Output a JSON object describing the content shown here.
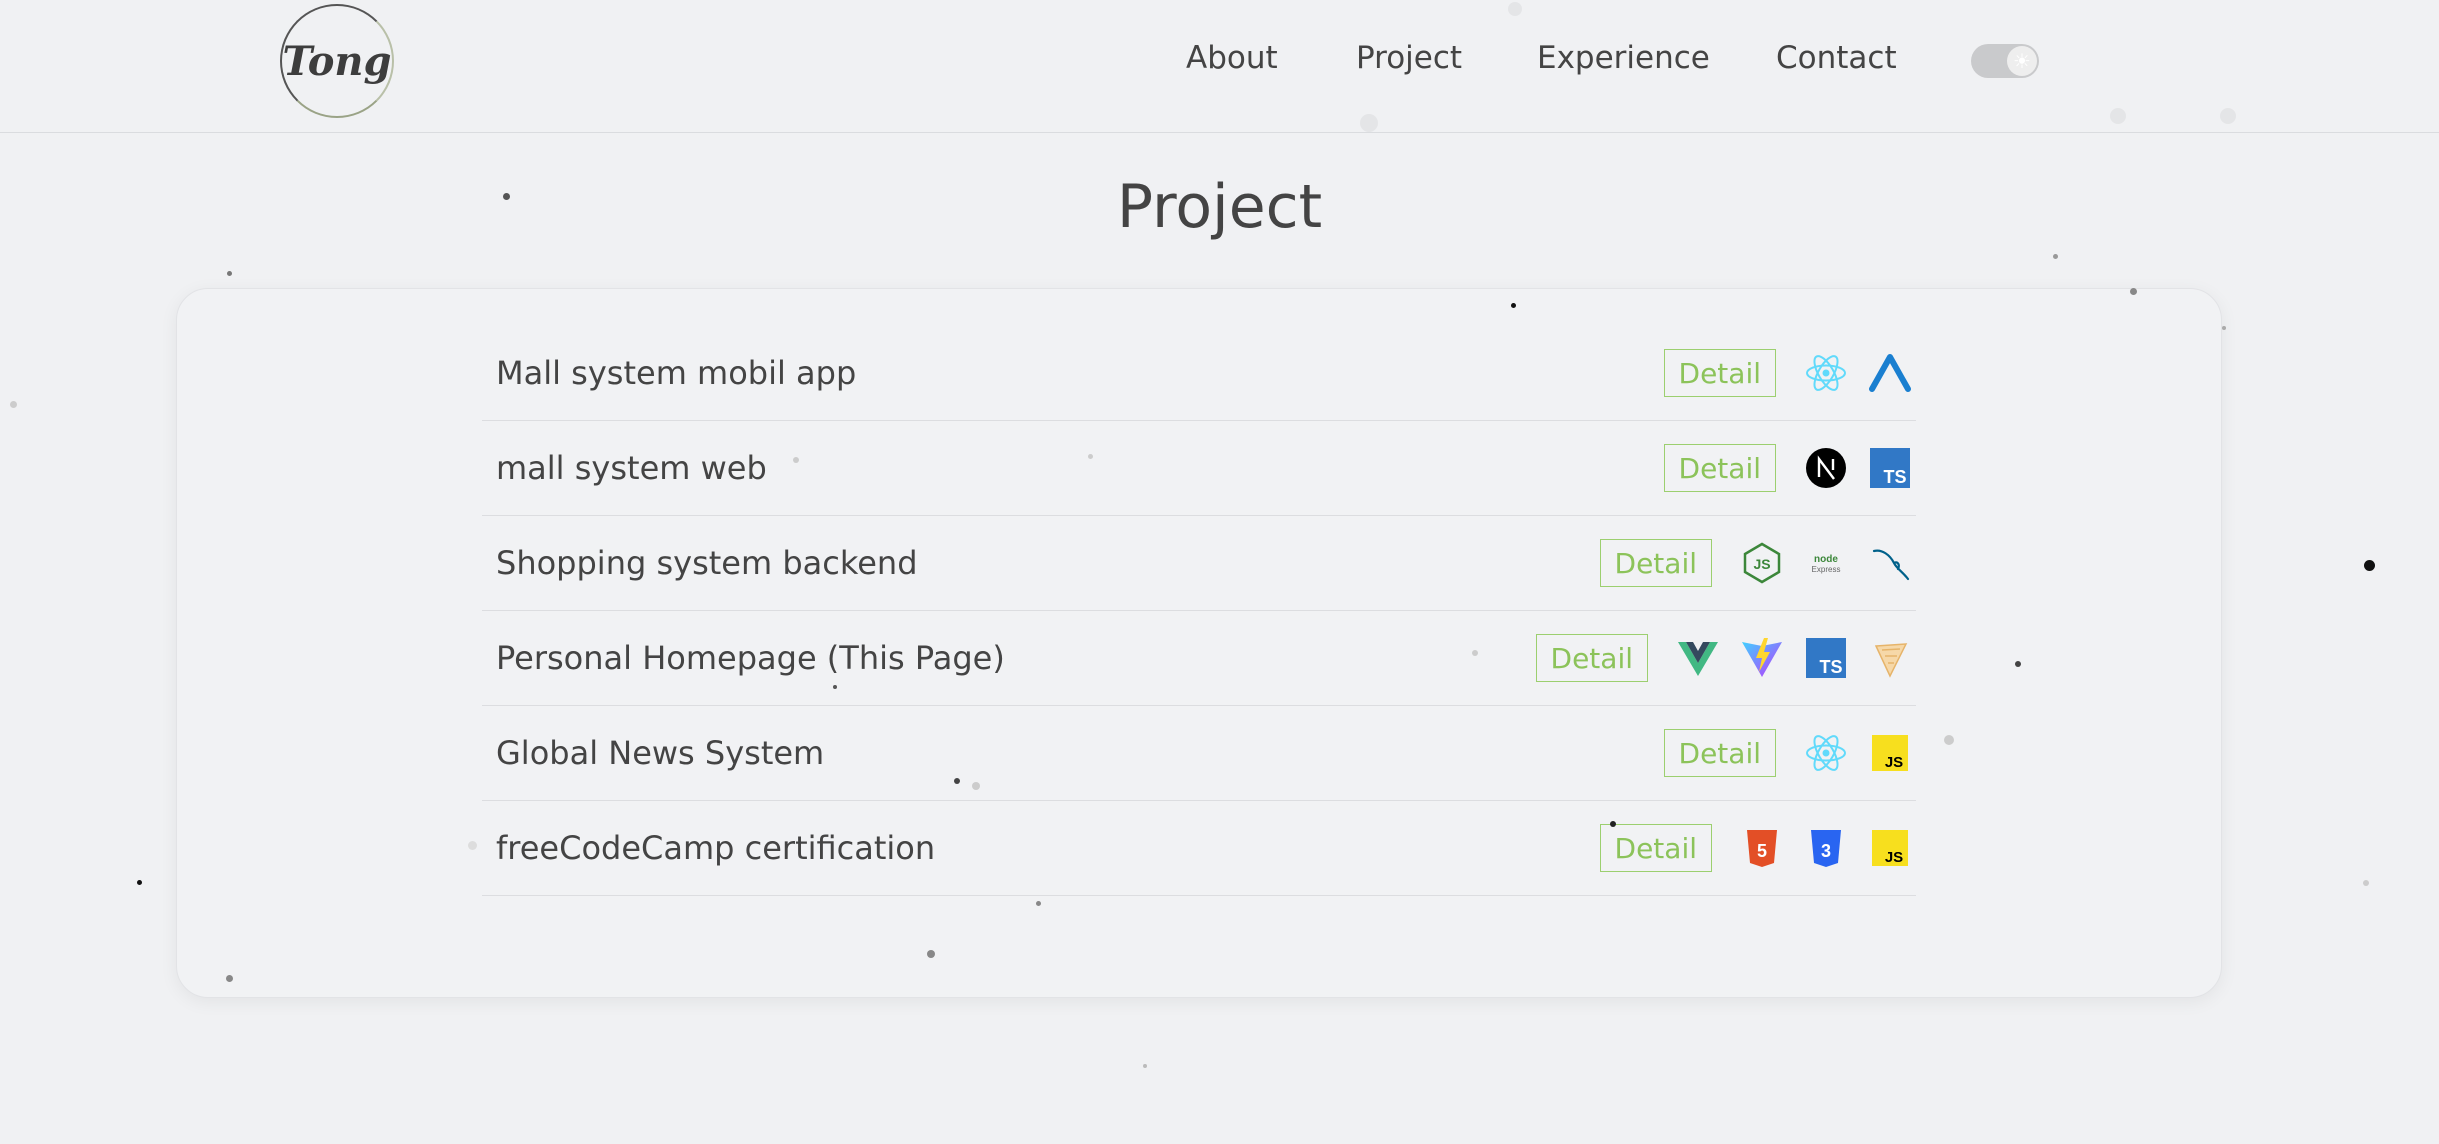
{
  "header": {
    "logo_text": "Tong",
    "nav": [
      {
        "label": "About"
      },
      {
        "label": "Project"
      },
      {
        "label": "Experience"
      },
      {
        "label": "Contact"
      }
    ],
    "theme_toggle": {
      "state": "light",
      "icon": "sun-icon"
    }
  },
  "page": {
    "title": "Project"
  },
  "projects": [
    {
      "title": "Mall system mobil app",
      "detail_label": "Detail",
      "tech": [
        "react-icon",
        "arco-icon"
      ]
    },
    {
      "title": "mall system web",
      "detail_label": "Detail",
      "tech": [
        "nextjs-icon",
        "typescript-icon"
      ]
    },
    {
      "title": "Shopping system backend",
      "detail_label": "Detail",
      "tech": [
        "nodejs-icon",
        "express-icon",
        "mysql-icon"
      ]
    },
    {
      "title": "Personal Homepage (This Page)",
      "detail_label": "Detail",
      "tech": [
        "vue-icon",
        "vite-icon",
        "typescript-icon",
        "pinia-icon"
      ]
    },
    {
      "title": "Global News System",
      "detail_label": "Detail",
      "tech": [
        "react-icon",
        "javascript-icon"
      ]
    },
    {
      "title": "freeCodeCamp certification",
      "detail_label": "Detail",
      "tech": [
        "html5-icon",
        "css3-icon",
        "javascript-icon"
      ]
    }
  ],
  "colors": {
    "background": "#f0f1f3",
    "text": "#444444",
    "detail_accent": "#8cc35a"
  }
}
